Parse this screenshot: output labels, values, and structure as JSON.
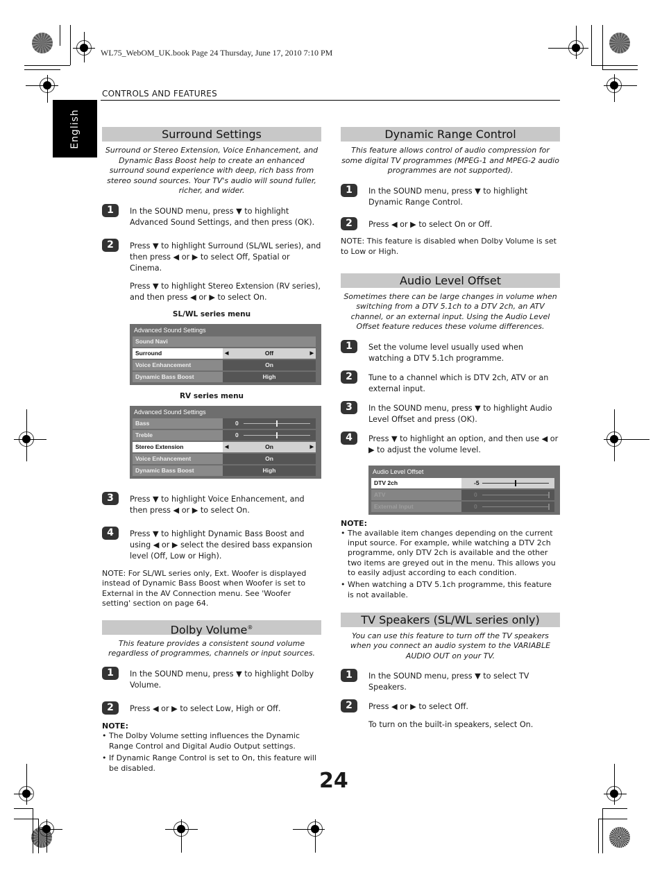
{
  "header": {
    "book_line": "WL75_WebOM_UK.book  Page 24  Thursday, June 17, 2010  7:10 PM",
    "section": "CONTROLS AND FEATURES",
    "language_tab": "English"
  },
  "page_number": "24",
  "left": {
    "surround": {
      "title": "Surround Settings",
      "intro": "Surround or Stereo Extension, Voice Enhancement, and Dynamic Bass Boost help to create an enhanced surround sound experience with deep, rich bass from stereo sound sources. Your TV's audio will sound fuller, richer, and wider.",
      "steps": [
        {
          "num": "1",
          "text": "In the SOUND menu, press ▼ to highlight Advanced Sound Settings, and then press (OK)."
        },
        {
          "num": "2",
          "text": "Press ▼ to highlight Surround (SL/WL series), and then press ◀ or ▶ to select Off, Spatial or Cinema."
        }
      ],
      "step2_extra": "Press ▼ to highlight Stereo Extension (RV series), and then press ◀ or ▶ to select On.",
      "menu_sl": {
        "caption": "SL/WL series menu",
        "title": "Advanced Sound Settings",
        "rows": [
          {
            "label": "Sound Navi",
            "value": ""
          },
          {
            "label": "Surround",
            "value": "Off"
          },
          {
            "label": "Voice Enhancement",
            "value": "On"
          },
          {
            "label": "Dynamic Bass Boost",
            "value": "High"
          }
        ]
      },
      "menu_rv": {
        "caption": "RV series menu",
        "title": "Advanced Sound Settings",
        "rows": [
          {
            "label": "Bass",
            "value": "0",
            "slider_position": 0.5
          },
          {
            "label": "Treble",
            "value": "0",
            "slider_position": 0.5
          },
          {
            "label": "Stereo Extension",
            "value": "On"
          },
          {
            "label": "Voice Enhancement",
            "value": "On"
          },
          {
            "label": "Dynamic Bass Boost",
            "value": "High"
          }
        ]
      },
      "steps_b": [
        {
          "num": "3",
          "text": "Press ▼ to highlight Voice Enhancement, and then press ◀ or ▶ to select On."
        },
        {
          "num": "4",
          "text": "Press ▼ to highlight Dynamic Bass Boost and using ◀ or ▶ select the desired bass expansion level (Off, Low or High)."
        }
      ],
      "note": "NOTE: For SL/WL series only, Ext. Woofer is displayed instead of Dynamic Bass Boost when Woofer is set to External in the AV Connection menu. See 'Woofer setting' section on page 64."
    },
    "dolby": {
      "title": "Dolby Volume",
      "title_mark": "®",
      "intro": "This feature provides a consistent sound volume regardless of programmes, channels or input sources.",
      "steps": [
        {
          "num": "1",
          "text": "In the SOUND menu, press ▼ to highlight Dolby Volume."
        },
        {
          "num": "2",
          "text": "Press ◀ or ▶ to select Low, High or Off."
        }
      ],
      "note_label": "NOTE:",
      "notes": [
        "The Dolby Volume setting influences the Dynamic Range Control and Digital Audio Output settings.",
        "If Dynamic Range Control is set to On, this feature will be disabled."
      ]
    }
  },
  "right": {
    "drc": {
      "title": "Dynamic Range Control",
      "intro": "This feature allows control of audio compression for some digital TV programmes (MPEG-1 and MPEG-2 audio programmes are not supported).",
      "steps": [
        {
          "num": "1",
          "text": "In the SOUND menu, press ▼ to highlight Dynamic Range Control."
        },
        {
          "num": "2",
          "text": "Press ◀ or ▶ to select On or Off."
        }
      ],
      "note": "NOTE: This feature is disabled when Dolby Volume is set to Low or High."
    },
    "alo": {
      "title": "Audio Level Offset",
      "intro": "Sometimes there can be large changes in volume when switching from a DTV 5.1ch to a DTV 2ch, an ATV channel, or an external input. Using the Audio Level Offset feature reduces these volume differences.",
      "steps": [
        {
          "num": "1",
          "text": "Set the volume level usually used when watching a DTV 5.1ch programme."
        },
        {
          "num": "2",
          "text": "Tune to a channel which is DTV 2ch, ATV or an external input."
        },
        {
          "num": "3",
          "text": "In the SOUND menu, press ▼ to highlight Audio Level Offset and press (OK)."
        },
        {
          "num": "4",
          "text": "Press ▼ to highlight an option, and then use ◀ or ▶ to adjust the volume level."
        }
      ],
      "menu": {
        "title": "Audio Level Offset",
        "rows": [
          {
            "label": "DTV 2ch",
            "value": "-5",
            "slider_position": 0.5,
            "enabled": true
          },
          {
            "label": "ATV",
            "value": "0",
            "slider_position": 1.0,
            "enabled": false
          },
          {
            "label": "External Input",
            "value": "0",
            "slider_position": 1.0,
            "enabled": false
          }
        ]
      },
      "note_label": "NOTE:",
      "notes": [
        "The available item changes depending on the current input source. For example, while watching a DTV 2ch programme, only DTV 2ch is available and the other two items are greyed out in the menu. This allows you to easily adjust according to each condition.",
        "When watching a DTV 5.1ch programme, this feature is not available."
      ]
    },
    "speakers": {
      "title": "TV Speakers (SL/WL series only)",
      "intro": "You can use this feature to turn off the TV speakers when you connect an audio system to the VARIABLE AUDIO OUT on your TV.",
      "steps": [
        {
          "num": "1",
          "text": "In the SOUND menu, press ▼ to select TV Speakers."
        },
        {
          "num": "2",
          "text": "Press ◀ or ▶ to select Off."
        }
      ],
      "extra": "To turn on the built-in speakers, select On."
    }
  }
}
